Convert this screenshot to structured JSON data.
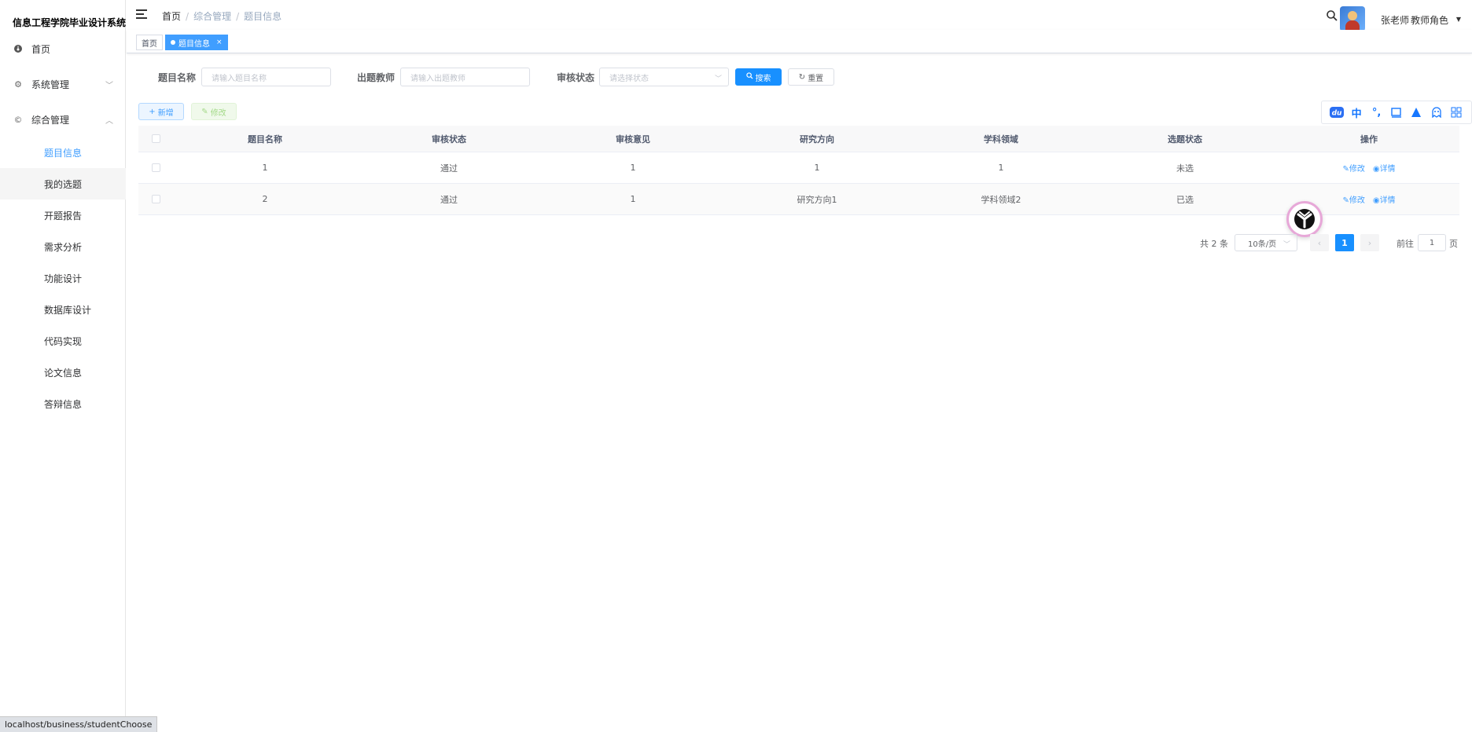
{
  "app": {
    "title": "信息工程学院毕业设计系统"
  },
  "sidebar": {
    "items": [
      {
        "label": "首页",
        "icon": "dashboard-icon"
      },
      {
        "label": "系统管理",
        "icon": "gear-icon"
      },
      {
        "label": "综合管理",
        "icon": "copyright-icon"
      }
    ],
    "sub_items": [
      {
        "label": "题目信息",
        "active": true
      },
      {
        "label": "我的选题"
      },
      {
        "label": "开题报告"
      },
      {
        "label": "需求分析"
      },
      {
        "label": "功能设计"
      },
      {
        "label": "数据库设计"
      },
      {
        "label": "代码实现"
      },
      {
        "label": "论文信息"
      },
      {
        "label": "答辩信息"
      }
    ]
  },
  "header": {
    "breadcrumb": [
      "首页",
      "综合管理",
      "题目信息"
    ],
    "breadcrumb_sep": "/",
    "user_name": "张老师",
    "user_role": "教师角色"
  },
  "tags": [
    {
      "label": "首页",
      "active": false
    },
    {
      "label": "题目信息",
      "active": true
    }
  ],
  "search_form": {
    "title_label": "题目名称",
    "title_placeholder": "请输入题目名称",
    "teacher_label": "出题教师",
    "teacher_placeholder": "请输入出题教师",
    "status_label": "审核状态",
    "status_placeholder": "请选择状态",
    "search_button": "搜索",
    "reset_button": "重置"
  },
  "toolbar": {
    "add_button": "新增",
    "edit_button": "修改"
  },
  "table": {
    "columns": [
      "题目名称",
      "审核状态",
      "审核意见",
      "研究方向",
      "学科领域",
      "选题状态",
      "操作"
    ],
    "rows": [
      {
        "title": "1",
        "audit_status": "通过",
        "audit_opinion": "1",
        "research": "1",
        "field": "1",
        "select_status": "未选"
      },
      {
        "title": "2",
        "audit_status": "通过",
        "audit_opinion": "1",
        "research": "研究方向1",
        "field": "学科领域2",
        "select_status": "已选"
      }
    ],
    "row_actions": {
      "edit": "修改",
      "detail": "详情"
    }
  },
  "pagination": {
    "total": "共 2 条",
    "page_size": "10条/页",
    "current_page": "1",
    "goto_label": "前往",
    "goto_value": "1",
    "page_suffix": "页"
  },
  "ime_toolbar": {
    "chinese_label": "中"
  },
  "status_bar": {
    "url": "localhost/business/studentChoose"
  }
}
